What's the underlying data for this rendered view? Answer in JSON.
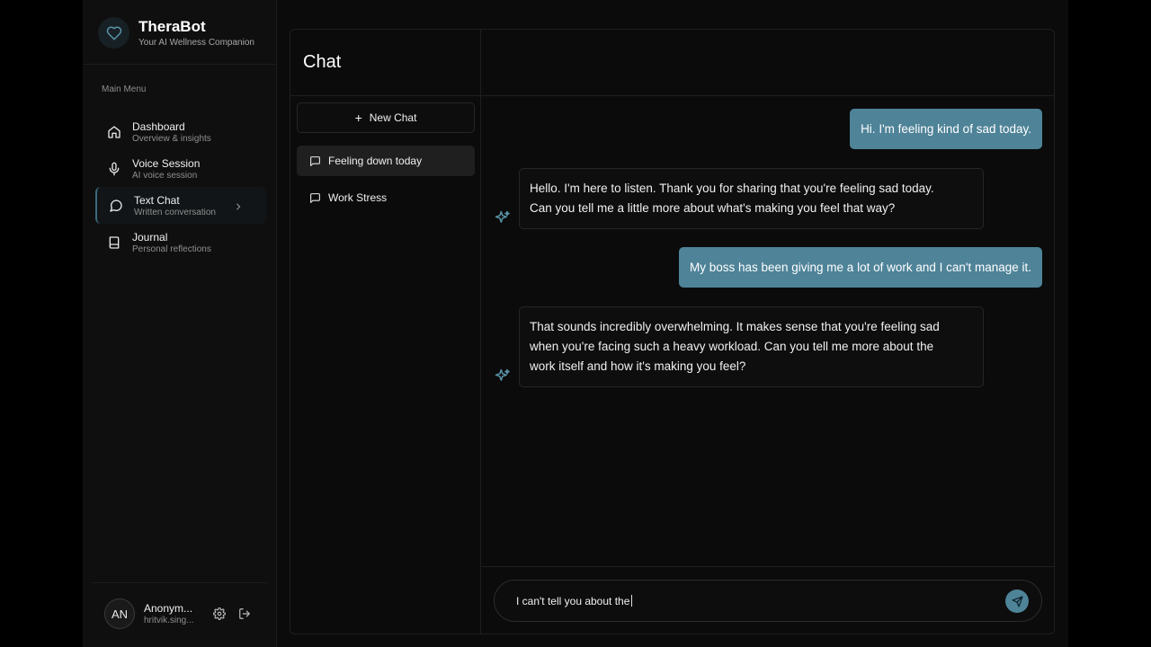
{
  "brand": {
    "name": "TheraBot",
    "tagline": "Your AI Wellness Companion"
  },
  "sidebar": {
    "menu_title": "Main Menu",
    "items": [
      {
        "label": "Dashboard",
        "sub": "Overview & insights",
        "icon": "home-icon"
      },
      {
        "label": "Voice Session",
        "sub": "AI voice session",
        "icon": "microphone-icon"
      },
      {
        "label": "Text Chat",
        "sub": "Written conversation",
        "icon": "chat-bubble-icon",
        "active": true
      },
      {
        "label": "Journal",
        "sub": "Personal reflections",
        "icon": "book-icon"
      }
    ]
  },
  "user": {
    "initials": "AN",
    "name": "Anonym...",
    "email": "hritvik.sing..."
  },
  "chat": {
    "title": "Chat",
    "new_chat_label": "New Chat",
    "conversations": [
      {
        "label": "Feeling down today",
        "active": true
      },
      {
        "label": "Work Stress",
        "active": false
      }
    ],
    "messages": [
      {
        "role": "user",
        "text": "Hi. I'm feeling kind of sad today."
      },
      {
        "role": "bot",
        "lines": [
          "Hello.  I'm here to listen.  Thank you for sharing that you're feeling sad today.",
          "Can you tell me a little more about what's making you feel that way?"
        ]
      },
      {
        "role": "user",
        "text": "My boss has been giving me a lot of work and I can't manage it."
      },
      {
        "role": "bot",
        "lines": [
          "That sounds incredibly overwhelming.  It makes sense that you're feeling sad",
          "when you're facing such a heavy workload.  Can you tell me more about the",
          "work itself and how it's making you feel?"
        ]
      }
    ],
    "input_value": "I can't tell you about the"
  },
  "colors": {
    "accent": "#4e8398",
    "background": "#0b0b0b"
  }
}
